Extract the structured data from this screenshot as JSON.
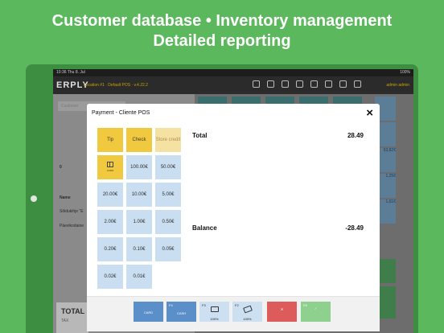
{
  "headline": {
    "line1": "Customer database • Inventory management",
    "line2": "Detailed reporting"
  },
  "status_bar": {
    "time": "10:36",
    "date": "Thu 8. Jul",
    "battery": "100%"
  },
  "app_bar": {
    "logo": "ERPLY",
    "location": "Location #1 · Default POS · v.4.22.2",
    "user": "admin admin"
  },
  "background": {
    "search_placeholder": "Customer",
    "zero": "0",
    "name_label": "Name",
    "row1": "Sõidukihje \"E",
    "row2": "Päevikodaine",
    "total_label": "TOTAL",
    "tax_label": "TAX",
    "tile_values": [
      "63,82€",
      "1,25€",
      "1,61€"
    ]
  },
  "modal": {
    "title": "Payment - Cliente POS",
    "close": "×",
    "keys": {
      "tip": "Tip",
      "check": "Check",
      "store_credit": "Store credit",
      "gift_card": "CARD",
      "v100": "100.00€",
      "v50": "50.00€",
      "v20": "20.00€",
      "v10": "10.00€",
      "v5": "5.00€",
      "v2": "2.00€",
      "v1": "1.00€",
      "v050": "0.50€",
      "v020": "0.20€",
      "v010": "0.10€",
      "v005": "0.05€",
      "v002": "0.02€",
      "v001": "0.01€"
    },
    "total_label": "Total",
    "total_value": "28.49",
    "balance_label": "Balance",
    "balance_value": "-28.49",
    "footer": {
      "card_label": "CARD",
      "cash_key": "F4",
      "cash_label": "CASH",
      "f3_key": "F3",
      "f3_pct": "100%",
      "f2_key": "F2",
      "f2_pct": "100%",
      "cancel": "✕",
      "ok_key": "F8",
      "ok": "✓"
    }
  },
  "colors": {
    "brand_green": "#5cb85c",
    "key_yellow": "#f0c93e",
    "key_blue": "#c9def0",
    "cancel_red": "#de5b5b",
    "ok_green": "#8ed08e"
  }
}
